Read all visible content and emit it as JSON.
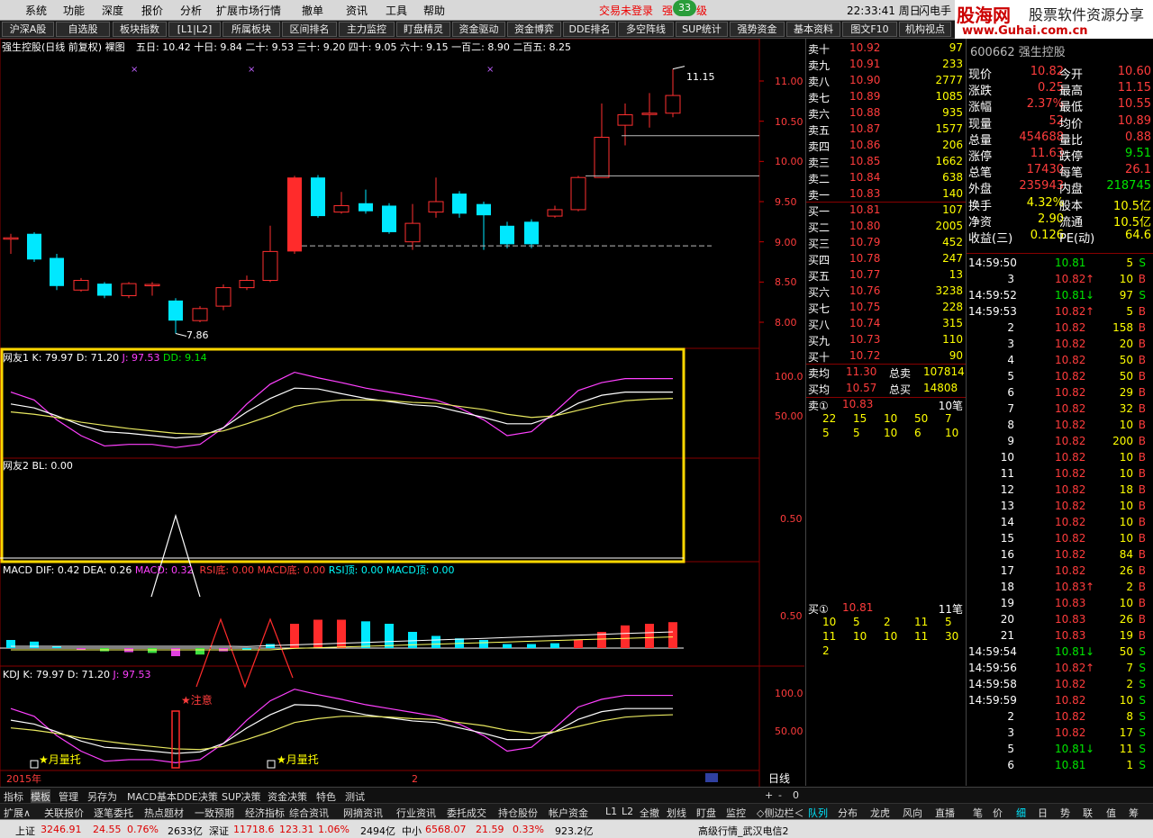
{
  "menu": [
    "系统",
    "功能",
    "深度",
    "报价",
    "分析",
    "扩展市场行情",
    "撤单",
    "资讯",
    "工具",
    "帮助"
  ],
  "trade_status": "交易未登录",
  "badge": "33",
  "badge_tail": "强",
  "badge_tail2": "级",
  "clock": "22:33:41 周日",
  "flash": "闪电手",
  "logo": {
    "brand": "股海网",
    "tagline": "股票软件资源分享",
    "url": "www.Guhai.com.cn"
  },
  "toolbar": [
    "沪深A股",
    "自选股",
    "板块指数",
    "[L1|L2]",
    "所属板块",
    "区间排名",
    "主力监控",
    "盯盘精灵",
    "资金驱动",
    "资金博弈",
    "DDE排名",
    "多空阵线",
    "SUP统计",
    "强势资金",
    "基本资料",
    "图文F10",
    "机构视点"
  ],
  "chart_header": {
    "name": "强生控股(日线 前复权) 裸图",
    "ma": "五日: 10.42 十日: 9.84 二十: 9.53 三十: 9.20 四十: 9.05 六十: 9.15 一百二: 8.90 二百五: 8.25"
  },
  "price_axis": [
    "11.00",
    "10.50",
    "10.00",
    "9.50",
    "9.00",
    "8.50",
    "8.00"
  ],
  "high_label": "11.15",
  "low_label": "7.86",
  "ind1_header": {
    "name": "网友1",
    "k": "K: 79.97",
    "d": "D: 71.20",
    "j": "J: 97.53",
    "dd": "DD: 9.14"
  },
  "ind1_axis": [
    "100.0",
    "50.00"
  ],
  "ind2_header": {
    "name": "网友2",
    "bl": "BL: 0.00"
  },
  "ind2_axis": [
    "0.50"
  ],
  "macd_header": {
    "name": "MACD",
    "dif": "DIF: 0.42",
    "dea": "DEA: 0.26",
    "macd": "MACD: 0.32",
    "rsi_di": "RSI底: 0.00",
    "macd_di": "MACD底: 0.00",
    "rsi_ding": "RSI顶: 0.00",
    "macd_ding": "MACD顶: 0.00"
  },
  "macd_axis": [
    "0.50"
  ],
  "kdj_header": {
    "name": "KDJ",
    "k": "K: 79.97",
    "d": "D: 71.20",
    "j": "J: 97.53"
  },
  "kdj_axis": [
    "100.0",
    "50.00"
  ],
  "kdj_notes": {
    "alert": "★注意",
    "support1": "★月量托",
    "support2": "★月量托"
  },
  "date_axis": {
    "year": "2015年",
    "mark": "2"
  },
  "period": "日线",
  "stock_code": "600662 强生控股",
  "sell_orders": [
    {
      "label": "卖十",
      "price": "10.92",
      "vol": "97"
    },
    {
      "label": "卖九",
      "price": "10.91",
      "vol": "233"
    },
    {
      "label": "卖八",
      "price": "10.90",
      "vol": "2777"
    },
    {
      "label": "卖七",
      "price": "10.89",
      "vol": "1085"
    },
    {
      "label": "卖六",
      "price": "10.88",
      "vol": "935"
    },
    {
      "label": "卖五",
      "price": "10.87",
      "vol": "1577"
    },
    {
      "label": "卖四",
      "price": "10.86",
      "vol": "206"
    },
    {
      "label": "卖三",
      "price": "10.85",
      "vol": "1662"
    },
    {
      "label": "卖二",
      "price": "10.84",
      "vol": "638"
    },
    {
      "label": "卖一",
      "price": "10.83",
      "vol": "140"
    }
  ],
  "buy_orders": [
    {
      "label": "买一",
      "price": "10.81",
      "vol": "107"
    },
    {
      "label": "买二",
      "price": "10.80",
      "vol": "2005"
    },
    {
      "label": "买三",
      "price": "10.79",
      "vol": "452"
    },
    {
      "label": "买四",
      "price": "10.78",
      "vol": "247"
    },
    {
      "label": "买五",
      "price": "10.77",
      "vol": "13"
    },
    {
      "label": "买六",
      "price": "10.76",
      "vol": "3238"
    },
    {
      "label": "买七",
      "price": "10.75",
      "vol": "228"
    },
    {
      "label": "买八",
      "price": "10.74",
      "vol": "315"
    },
    {
      "label": "买九",
      "price": "10.73",
      "vol": "110"
    },
    {
      "label": "买十",
      "price": "10.72",
      "vol": "90"
    }
  ],
  "avg": {
    "sell_avg_label": "卖均",
    "sell_avg": "11.30",
    "sell_total_label": "总卖",
    "sell_total": "107814",
    "buy_avg_label": "买均",
    "buy_avg": "10.57",
    "buy_total_label": "总买",
    "buy_total": "14808"
  },
  "queue_sell": {
    "label": "卖①",
    "price": "10.83",
    "count": "10笔",
    "row1": [
      "22",
      "15",
      "10",
      "50",
      "7"
    ],
    "row2": [
      "5",
      "5",
      "10",
      "6",
      "10"
    ]
  },
  "queue_buy": {
    "label": "买①",
    "price": "10.81",
    "count": "11笔",
    "row1": [
      "10",
      "5",
      "2",
      "11",
      "5"
    ],
    "row2": [
      "11",
      "10",
      "10",
      "11",
      "30"
    ],
    "row3": [
      "2"
    ]
  },
  "stats": [
    {
      "l1": "现价",
      "v1": "10.82",
      "l2": "今开",
      "v2": "10.60"
    },
    {
      "l1": "涨跌",
      "v1": "0.25",
      "l2": "最高",
      "v2": "11.15"
    },
    {
      "l1": "涨幅",
      "v1": "2.37%",
      "l2": "最低",
      "v2": "10.55"
    },
    {
      "l1": "现量",
      "v1": "52",
      "l2": "均价",
      "v2": "10.89"
    },
    {
      "l1": "总量",
      "v1": "454688",
      "l2": "量比",
      "v2": "0.88"
    },
    {
      "l1": "涨停",
      "v1": "11.63",
      "l2": "跌停",
      "v2": "9.51"
    },
    {
      "l1": "总笔",
      "v1": "17430",
      "l2": "每笔",
      "v2": "26.1"
    },
    {
      "l1": "外盘",
      "v1": "235943",
      "l2": "内盘",
      "v2": "218745"
    },
    {
      "l1": "换手",
      "v1": "4.32%",
      "l2": "股本",
      "v2": "10.5亿"
    },
    {
      "l1": "净资",
      "v1": "2.90",
      "l2": "流通",
      "v2": "10.5亿"
    },
    {
      "l1": "收益(三)",
      "v1": "0.126",
      "l2": "PE(动)",
      "v2": "64.6"
    }
  ],
  "ticks": [
    {
      "t": "14:59:50",
      "p": "10.81",
      "v": "5",
      "s": "S",
      "arrow": ""
    },
    {
      "t": "3",
      "p": "10.82",
      "v": "10",
      "s": "B",
      "arrow": "↑"
    },
    {
      "t": "14:59:52",
      "p": "10.81",
      "v": "97",
      "s": "S",
      "arrow": "↓"
    },
    {
      "t": "14:59:53",
      "p": "10.82",
      "v": "5",
      "s": "B",
      "arrow": "↑"
    },
    {
      "t": "2",
      "p": "10.82",
      "v": "158",
      "s": "B",
      "arrow": ""
    },
    {
      "t": "3",
      "p": "10.82",
      "v": "20",
      "s": "B",
      "arrow": ""
    },
    {
      "t": "4",
      "p": "10.82",
      "v": "50",
      "s": "B",
      "arrow": ""
    },
    {
      "t": "5",
      "p": "10.82",
      "v": "50",
      "s": "B",
      "arrow": ""
    },
    {
      "t": "6",
      "p": "10.82",
      "v": "29",
      "s": "B",
      "arrow": ""
    },
    {
      "t": "7",
      "p": "10.82",
      "v": "32",
      "s": "B",
      "arrow": ""
    },
    {
      "t": "8",
      "p": "10.82",
      "v": "10",
      "s": "B",
      "arrow": ""
    },
    {
      "t": "9",
      "p": "10.82",
      "v": "200",
      "s": "B",
      "arrow": ""
    },
    {
      "t": "10",
      "p": "10.82",
      "v": "10",
      "s": "B",
      "arrow": ""
    },
    {
      "t": "11",
      "p": "10.82",
      "v": "10",
      "s": "B",
      "arrow": ""
    },
    {
      "t": "12",
      "p": "10.82",
      "v": "18",
      "s": "B",
      "arrow": ""
    },
    {
      "t": "13",
      "p": "10.82",
      "v": "10",
      "s": "B",
      "arrow": ""
    },
    {
      "t": "14",
      "p": "10.82",
      "v": "10",
      "s": "B",
      "arrow": ""
    },
    {
      "t": "15",
      "p": "10.82",
      "v": "10",
      "s": "B",
      "arrow": ""
    },
    {
      "t": "16",
      "p": "10.82",
      "v": "84",
      "s": "B",
      "arrow": ""
    },
    {
      "t": "17",
      "p": "10.82",
      "v": "26",
      "s": "B",
      "arrow": ""
    },
    {
      "t": "18",
      "p": "10.83",
      "v": "2",
      "s": "B",
      "arrow": "↑"
    },
    {
      "t": "19",
      "p": "10.83",
      "v": "10",
      "s": "B",
      "arrow": ""
    },
    {
      "t": "20",
      "p": "10.83",
      "v": "26",
      "s": "B",
      "arrow": ""
    },
    {
      "t": "21",
      "p": "10.83",
      "v": "19",
      "s": "B",
      "arrow": ""
    },
    {
      "t": "14:59:54",
      "p": "10.81",
      "v": "50",
      "s": "S",
      "arrow": "↓"
    },
    {
      "t": "14:59:56",
      "p": "10.82",
      "v": "7",
      "s": "S",
      "arrow": "↑"
    },
    {
      "t": "14:59:58",
      "p": "10.82",
      "v": "2",
      "s": "S",
      "arrow": ""
    },
    {
      "t": "14:59:59",
      "p": "10.82",
      "v": "10",
      "s": "S",
      "arrow": ""
    },
    {
      "t": "2",
      "p": "10.82",
      "v": "8",
      "s": "S",
      "arrow": ""
    },
    {
      "t": "3",
      "p": "10.82",
      "v": "17",
      "s": "S",
      "arrow": ""
    },
    {
      "t": "5",
      "p": "10.81",
      "v": "11",
      "s": "S",
      "arrow": "↓"
    },
    {
      "t": "6",
      "p": "10.81",
      "v": "1",
      "s": "S",
      "arrow": ""
    }
  ],
  "bottom_tabs1": [
    "指标",
    "模板",
    "管理",
    "另存为",
    "MACD基本",
    "DDE决策",
    "SUP决策",
    "资金决策",
    "特色",
    "测试"
  ],
  "bottom_tabs1_right": [
    "+",
    "-",
    "0"
  ],
  "bottom_tabs2": [
    "扩展∧",
    "关联报价",
    "逐笔委托",
    "热点题材",
    "一致预期",
    "经济指标",
    "综合资讯",
    "网摘资讯",
    "行业资讯",
    "委托成交",
    "持仓股份",
    "帐户资金"
  ],
  "bottom_tabs2_mid": [
    "L1",
    "L2",
    "全撤",
    "划线",
    "盯盘",
    "监控",
    "◇侧边栏＜"
  ],
  "bottom_tabs2_right": [
    "队列",
    "分布",
    "龙虎",
    "风向",
    "直播"
  ],
  "right_tabs": [
    "笔",
    "价",
    "细",
    "日",
    "势",
    "联",
    "值",
    "筹"
  ],
  "status": {
    "sh": "上证",
    "sh_v": "3246.91",
    "sh_c": "24.55",
    "sh_p": "0.76%",
    "sh_a": "2633亿",
    "sz": "深证",
    "sz_v": "11718.6",
    "sz_c": "123.31",
    "sz_p": "1.06%",
    "sz_a": "2494亿",
    "zx": "中小",
    "zx_v": "6568.07",
    "zx_c": "21.59",
    "zx_p": "0.33%",
    "zx_a": "923.2亿",
    "server": "高级行情_武汉电信2"
  }
}
